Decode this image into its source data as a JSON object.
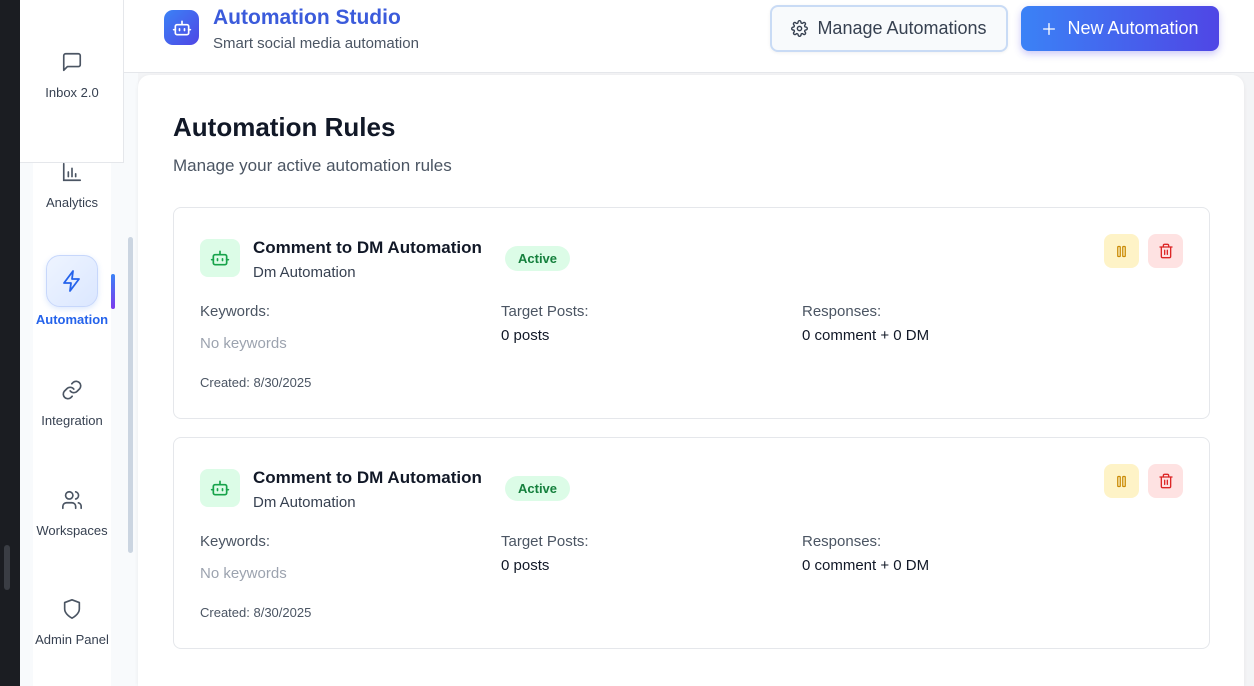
{
  "sidebar": {
    "items": [
      {
        "label": "Inbox 2.0",
        "icon": "message-square-icon"
      },
      {
        "label": "Analytics",
        "icon": "bar-chart-icon"
      },
      {
        "label": "Automation",
        "icon": "zap-icon",
        "active": true
      },
      {
        "label": "Integration",
        "icon": "link-icon"
      },
      {
        "label": "Workspaces",
        "icon": "users-icon"
      },
      {
        "label": "Admin Panel",
        "icon": "shield-icon"
      }
    ]
  },
  "header": {
    "title": "Automation Studio",
    "subtitle": "Smart social media automation",
    "logo_icon": "bot-icon",
    "manage_button": "Manage Automations",
    "new_button": "New Automation"
  },
  "main": {
    "title": "Automation Rules",
    "subtitle": "Manage your active automation rules",
    "rules": [
      {
        "name": "Comment to DM Automation",
        "type": "Dm Automation",
        "status": "Active",
        "keywords_label": "Keywords:",
        "keywords_value": "No keywords",
        "target_label": "Target Posts:",
        "target_value": "0 posts",
        "responses_label": "Responses:",
        "responses_value": "0 comment + 0 DM",
        "created": "Created: 8/30/2025"
      },
      {
        "name": "Comment to DM Automation",
        "type": "Dm Automation",
        "status": "Active",
        "keywords_label": "Keywords:",
        "keywords_value": "No keywords",
        "target_label": "Target Posts:",
        "target_value": "0 posts",
        "responses_label": "Responses:",
        "responses_value": "0 comment + 0 DM",
        "created": "Created: 8/30/2025"
      }
    ]
  },
  "colors": {
    "accent": "#3b82f6",
    "accent_dark": "#4f46e5",
    "status_active_bg": "#dcfce7",
    "status_active_text": "#15803d",
    "pause_bg": "#fef3c7",
    "delete_bg": "#fee2e2"
  }
}
